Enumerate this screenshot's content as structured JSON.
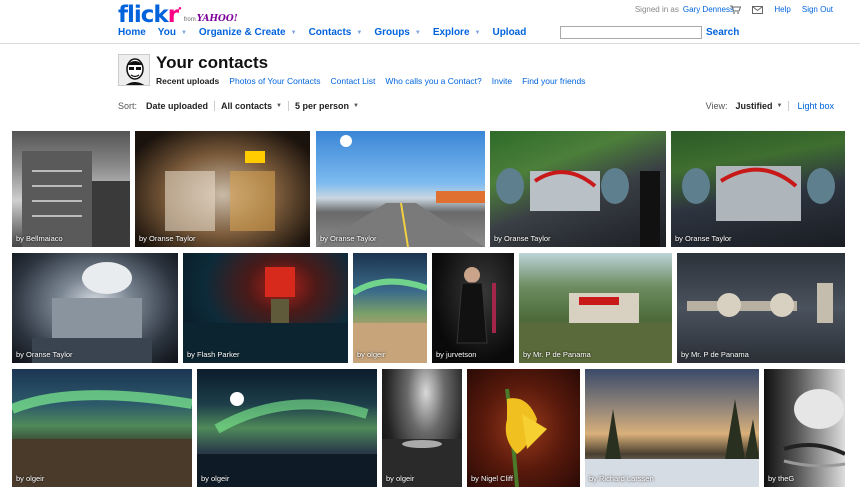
{
  "header": {
    "logo_text_main": "flick",
    "logo_text_accent": "r",
    "logo_from": "from",
    "logo_partner": "YAHOO!",
    "signed_in_label": "Signed in as",
    "signed_in_user": "Gary Denness",
    "help": "Help",
    "sign_out": "Sign Out"
  },
  "nav": {
    "items": [
      {
        "label": "Home",
        "has_menu": false
      },
      {
        "label": "You",
        "has_menu": true
      },
      {
        "label": "Organize & Create",
        "has_menu": true
      },
      {
        "label": "Contacts",
        "has_menu": true
      },
      {
        "label": "Groups",
        "has_menu": true
      },
      {
        "label": "Explore",
        "has_menu": true
      },
      {
        "label": "Upload",
        "has_menu": false
      }
    ],
    "search_value": "",
    "search_button": "Search"
  },
  "page": {
    "title": "Your contacts",
    "subnav": [
      {
        "label": "Recent uploads",
        "active": true
      },
      {
        "label": "Photos of Your Contacts",
        "active": false
      },
      {
        "label": "Contact List",
        "active": false
      },
      {
        "label": "Who calls you a Contact?",
        "active": false
      },
      {
        "label": "Invite",
        "active": false
      },
      {
        "label": "Find your friends",
        "active": false
      }
    ]
  },
  "sortbar": {
    "label": "Sort:",
    "options": [
      "Date uploaded",
      "All contacts",
      "5 per person"
    ],
    "view_label": "View:",
    "view_value": "Justified",
    "lightbox": "Light box"
  },
  "photos": [
    {
      "caption": "by Bellmaiaco"
    },
    {
      "caption": "by Oranse Taylor"
    },
    {
      "caption": "by Oranse Taylor"
    },
    {
      "caption": "by Oranse Taylor"
    },
    {
      "caption": "by Oranse Taylor"
    },
    {
      "caption": "by Oranse Taylor"
    },
    {
      "caption": "by Flash Parker"
    },
    {
      "caption": "by olgeir"
    },
    {
      "caption": "by jurvetson"
    },
    {
      "caption": "by Mr. P de Panama"
    },
    {
      "caption": "by Mr. P de Panama"
    },
    {
      "caption": "by olgeir"
    },
    {
      "caption": "by olgeir"
    },
    {
      "caption": "by olgeir"
    },
    {
      "caption": "by Nigel Cliff"
    },
    {
      "caption": "by Richard Larssen"
    },
    {
      "caption": "by theG"
    }
  ]
}
